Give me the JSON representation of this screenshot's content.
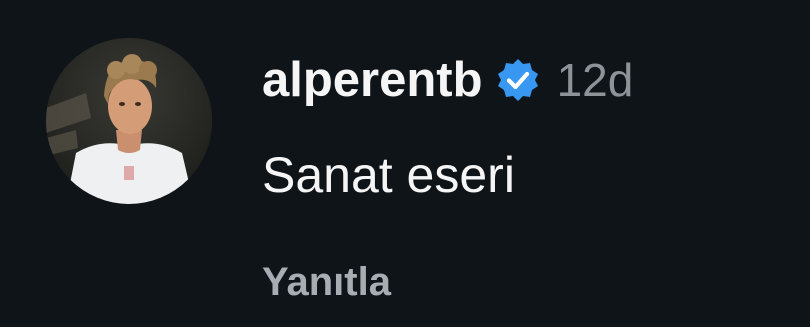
{
  "comment": {
    "username": "alperentb",
    "verified": true,
    "timestamp": "12d",
    "text": "Sanat eseri",
    "reply_label": "Yanıtla"
  },
  "colors": {
    "background": "#0f1419",
    "username": "#f5f5f5",
    "timestamp": "#8e9399",
    "text": "#f5f5f5",
    "reply": "#a8adb3",
    "verified_badge": "#3897f0"
  },
  "icons": {
    "verified": "verified-badge-icon",
    "avatar": "profile-avatar"
  }
}
